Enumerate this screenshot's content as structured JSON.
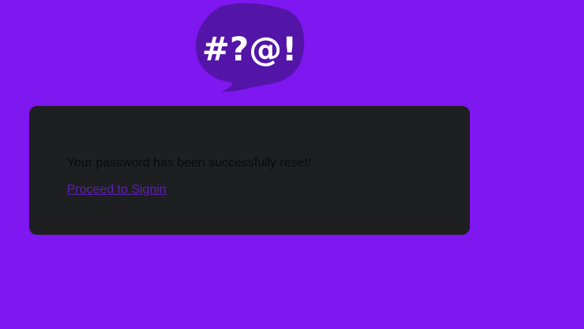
{
  "logo": {
    "icon": "speech-bubble-icon",
    "text": "#?@!",
    "bubble_color": "#5315a8",
    "text_color": "#ffffff"
  },
  "colors": {
    "background": "#7e17f0",
    "card": "#1e1f21",
    "message_text": "#0a0a0a",
    "link": "#5c1fb8"
  },
  "reset_card": {
    "message": "Your password has been successfully reset!",
    "signin_link_label": "Proceed to Signin"
  }
}
